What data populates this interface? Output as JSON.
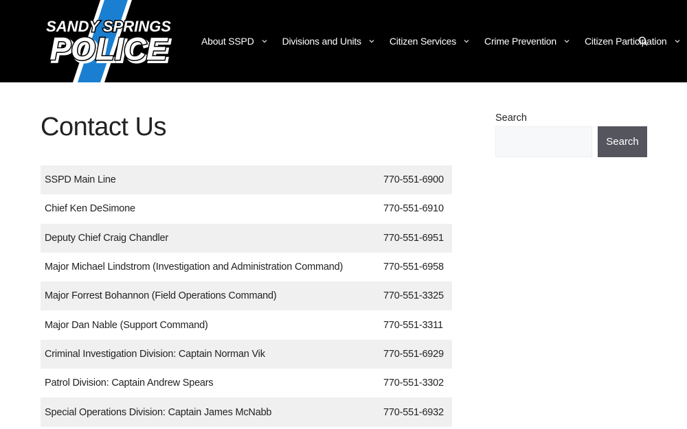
{
  "header": {
    "logo": {
      "line1": "SANDY SPRINGS",
      "line2": "POLICE",
      "alt": "Sandy Springs Police logo"
    },
    "nav": [
      {
        "label": "About SSPD",
        "has_dropdown": true
      },
      {
        "label": "Divisions and Units",
        "has_dropdown": true
      },
      {
        "label": "Citizen Services",
        "has_dropdown": true
      },
      {
        "label": "Crime Prevention",
        "has_dropdown": true
      },
      {
        "label": "Citizen Participation",
        "has_dropdown": true
      }
    ],
    "search_icon": "search-icon"
  },
  "main": {
    "title": "Contact Us",
    "contacts": [
      {
        "name": "SSPD Main Line",
        "phone": "770-551-6900"
      },
      {
        "name": "Chief Ken DeSimone",
        "phone": "770-551-6910"
      },
      {
        "name": "Deputy Chief Craig Chandler",
        "phone": "770-551-6951"
      },
      {
        "name": "Major Michael Lindstrom (Investigation and Administration Command)",
        "phone": "770-551-6958"
      },
      {
        "name": "Major Forrest Bohannon (Field Operations Command)",
        "phone": "770-551-3325"
      },
      {
        "name": "Major Dan Nable (Support Command)",
        "phone": "770-551-3311"
      },
      {
        "name": "Criminal Investigation Division: Captain Norman Vik",
        "phone": "770-551-6929"
      },
      {
        "name": "Patrol Division: Captain Andrew Spears",
        "phone": "770-551-3302"
      },
      {
        "name": "Special Operations Division: Captain James McNabb",
        "phone": "770-551-6932"
      }
    ]
  },
  "sidebar": {
    "search_label": "Search",
    "search_value": "",
    "search_placeholder": "",
    "search_button": "Search"
  },
  "colors": {
    "header_bg": "#000000",
    "logo_blue": "#1b7fd1",
    "row_stripe": "#f0f0f0",
    "button_bg": "#55555e"
  }
}
